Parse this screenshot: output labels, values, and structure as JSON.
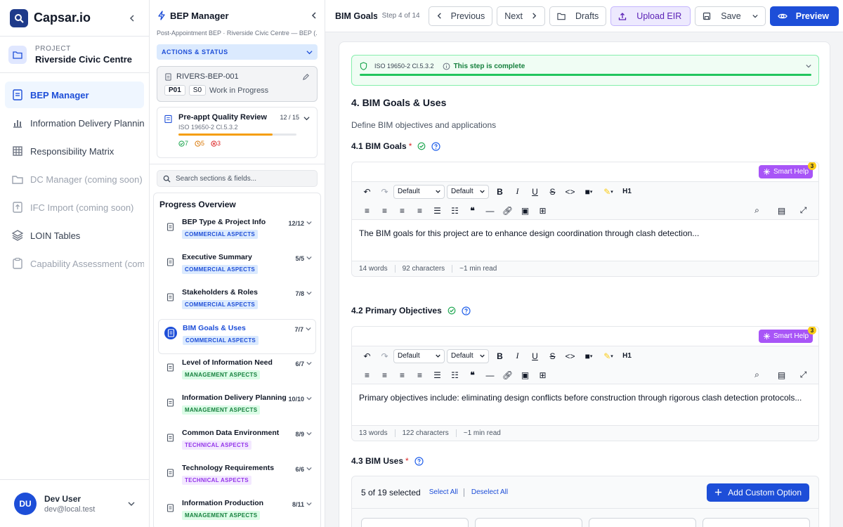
{
  "app": {
    "name": "Capsar.io"
  },
  "project": {
    "kicker": "PROJECT",
    "name": "Riverside Civic Centre"
  },
  "nav": [
    {
      "label": "BEP Manager",
      "icon": "file-text-icon",
      "state": "active"
    },
    {
      "label": "Information Delivery Planning",
      "icon": "bar-chart-icon",
      "state": "normal"
    },
    {
      "label": "Responsibility Matrix",
      "icon": "grid-icon",
      "state": "normal"
    },
    {
      "label": "DC Manager (coming soon)",
      "icon": "folder-icon",
      "state": "disabled"
    },
    {
      "label": "IFC Import (coming soon)",
      "icon": "upload-file-icon",
      "state": "disabled"
    },
    {
      "label": "LOIN Tables",
      "icon": "layers-icon",
      "state": "normal"
    },
    {
      "label": "Capability Assessment (coming soon)",
      "icon": "clipboard-icon",
      "state": "disabled"
    }
  ],
  "user": {
    "initials": "DU",
    "name": "Dev User",
    "email": "dev@local.test"
  },
  "bep": {
    "title": "BEP Manager",
    "breadcrumb": "Post-Appointment BEP · Riverside Civic Centre — BEP (...",
    "actions_label": "ACTIONS & STATUS",
    "doc_code": "RIVERS-BEP-001",
    "revision": "P01",
    "suitability": "S0",
    "status": "Work in Progress",
    "review": {
      "title": "Pre-appt Quality Review",
      "standard": "ISO 19650-2 Cl.5.3.2",
      "count": "12 / 15",
      "progress": 0.8,
      "ok": "7",
      "warn": "5",
      "err": "3"
    },
    "search_placeholder": "Search sections & fields...",
    "progress_title": "Progress Overview",
    "sections": [
      {
        "title": "BEP Type & Project Info",
        "tag": "COMMERCIAL ASPECTS",
        "kind": "commercial",
        "count": "12/12",
        "active": false
      },
      {
        "title": "Executive Summary",
        "tag": "COMMERCIAL ASPECTS",
        "kind": "commercial",
        "count": "5/5",
        "active": false
      },
      {
        "title": "Stakeholders & Roles",
        "tag": "COMMERCIAL ASPECTS",
        "kind": "commercial",
        "count": "7/8",
        "active": false
      },
      {
        "title": "BIM Goals & Uses",
        "tag": "COMMERCIAL ASPECTS",
        "kind": "commercial",
        "count": "7/7",
        "active": true
      },
      {
        "title": "Level of Information Need",
        "tag": "MANAGEMENT ASPECTS",
        "kind": "management",
        "count": "6/7",
        "active": false
      },
      {
        "title": "Information Delivery Planning",
        "tag": "MANAGEMENT ASPECTS",
        "kind": "management",
        "count": "10/10",
        "active": false
      },
      {
        "title": "Common Data Environment",
        "tag": "TECHNICAL ASPECTS",
        "kind": "technical",
        "count": "8/9",
        "active": false
      },
      {
        "title": "Technology Requirements",
        "tag": "TECHNICAL ASPECTS",
        "kind": "technical",
        "count": "6/6",
        "active": false
      },
      {
        "title": "Information Production",
        "tag": "MANAGEMENT ASPECTS",
        "kind": "management",
        "count": "8/11",
        "active": false
      }
    ]
  },
  "toolbar": {
    "title": "BIM Goals & U...",
    "step": "Step 4 of 14",
    "previous": "Previous",
    "next": "Next",
    "drafts": "Drafts",
    "upload": "Upload EIR",
    "save": "Save",
    "preview": "Preview"
  },
  "content": {
    "iso": "ISO 19650-2 Cl.5.3.2",
    "complete_msg": "This step is complete",
    "step_heading": "4. BIM Goals & Uses",
    "step_desc": "Define BIM objectives and applications",
    "field1": {
      "label": "4.1 BIM Goals",
      "smart_help": "Smart Help",
      "smart_count": "3",
      "text": "The BIM goals for this project are to enhance design coordination through clash detection...",
      "words": "14 words",
      "chars": "92 characters",
      "read": "~1 min read"
    },
    "field2": {
      "label": "4.2 Primary Objectives",
      "smart_help": "Smart Help",
      "smart_count": "3",
      "text": "Primary objectives include: eliminating design conflicts before construction through rigorous clash detection protocols...",
      "words": "13 words",
      "chars": "122 characters",
      "read": "~1 min read"
    },
    "field3": {
      "label": "4.3 BIM Uses",
      "selected": "5 of 19 selected",
      "select_all": "Select All",
      "deselect_all": "Deselect All",
      "add_custom": "Add Custom Option"
    },
    "editor": {
      "font_default": "Default",
      "size_default": "Default",
      "heading": "H1"
    }
  }
}
